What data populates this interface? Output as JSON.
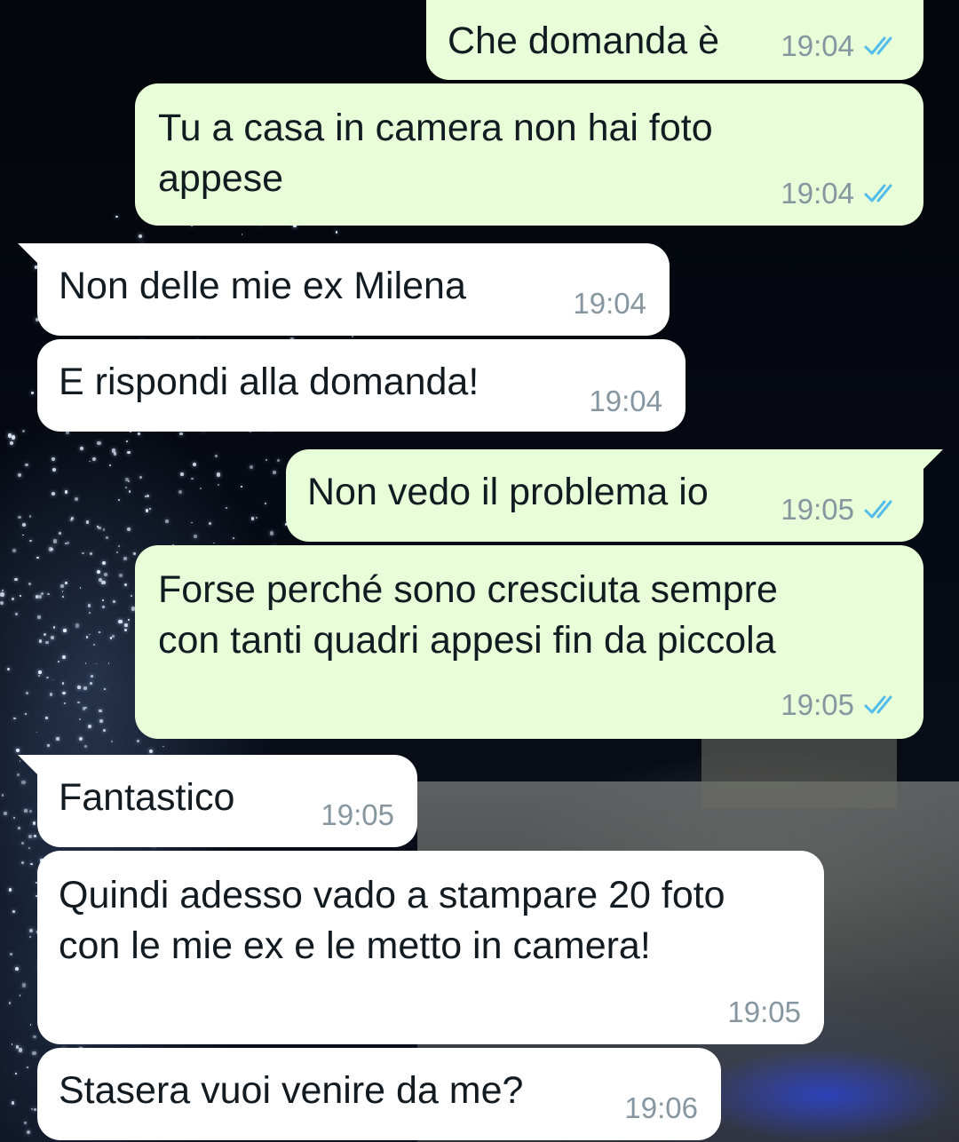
{
  "chat": {
    "colors": {
      "outgoing_bubble": "#e7fed9",
      "incoming_bubble": "#ffffff",
      "timestamp": "#8696a0",
      "read_ticks": "#53bdeb"
    },
    "messages": [
      {
        "direction": "outgoing",
        "text": "Che domanda è",
        "time": "19:04",
        "status": "read"
      },
      {
        "direction": "outgoing",
        "line1": "Tu a casa in camera non hai foto",
        "line2": "appese",
        "time": "19:04",
        "status": "read"
      },
      {
        "direction": "incoming",
        "text": "Non delle mie ex Milena",
        "time": "19:04"
      },
      {
        "direction": "incoming",
        "text": "E rispondi alla domanda!",
        "time": "19:04"
      },
      {
        "direction": "outgoing",
        "text": "Non vedo il problema io",
        "time": "19:05",
        "status": "read"
      },
      {
        "direction": "outgoing",
        "line1": "Forse perché sono cresciuta sempre",
        "line2": "con tanti quadri appesi fin da piccola",
        "time": "19:05",
        "status": "read"
      },
      {
        "direction": "incoming",
        "text": "Fantastico",
        "time": "19:05"
      },
      {
        "direction": "incoming",
        "line1": "Quindi adesso vado a stampare 20 foto",
        "line2": "con le mie ex e le metto in camera!",
        "time": "19:05"
      },
      {
        "direction": "incoming",
        "text": "Stasera vuoi venire da me?",
        "time": "19:06"
      }
    ]
  }
}
